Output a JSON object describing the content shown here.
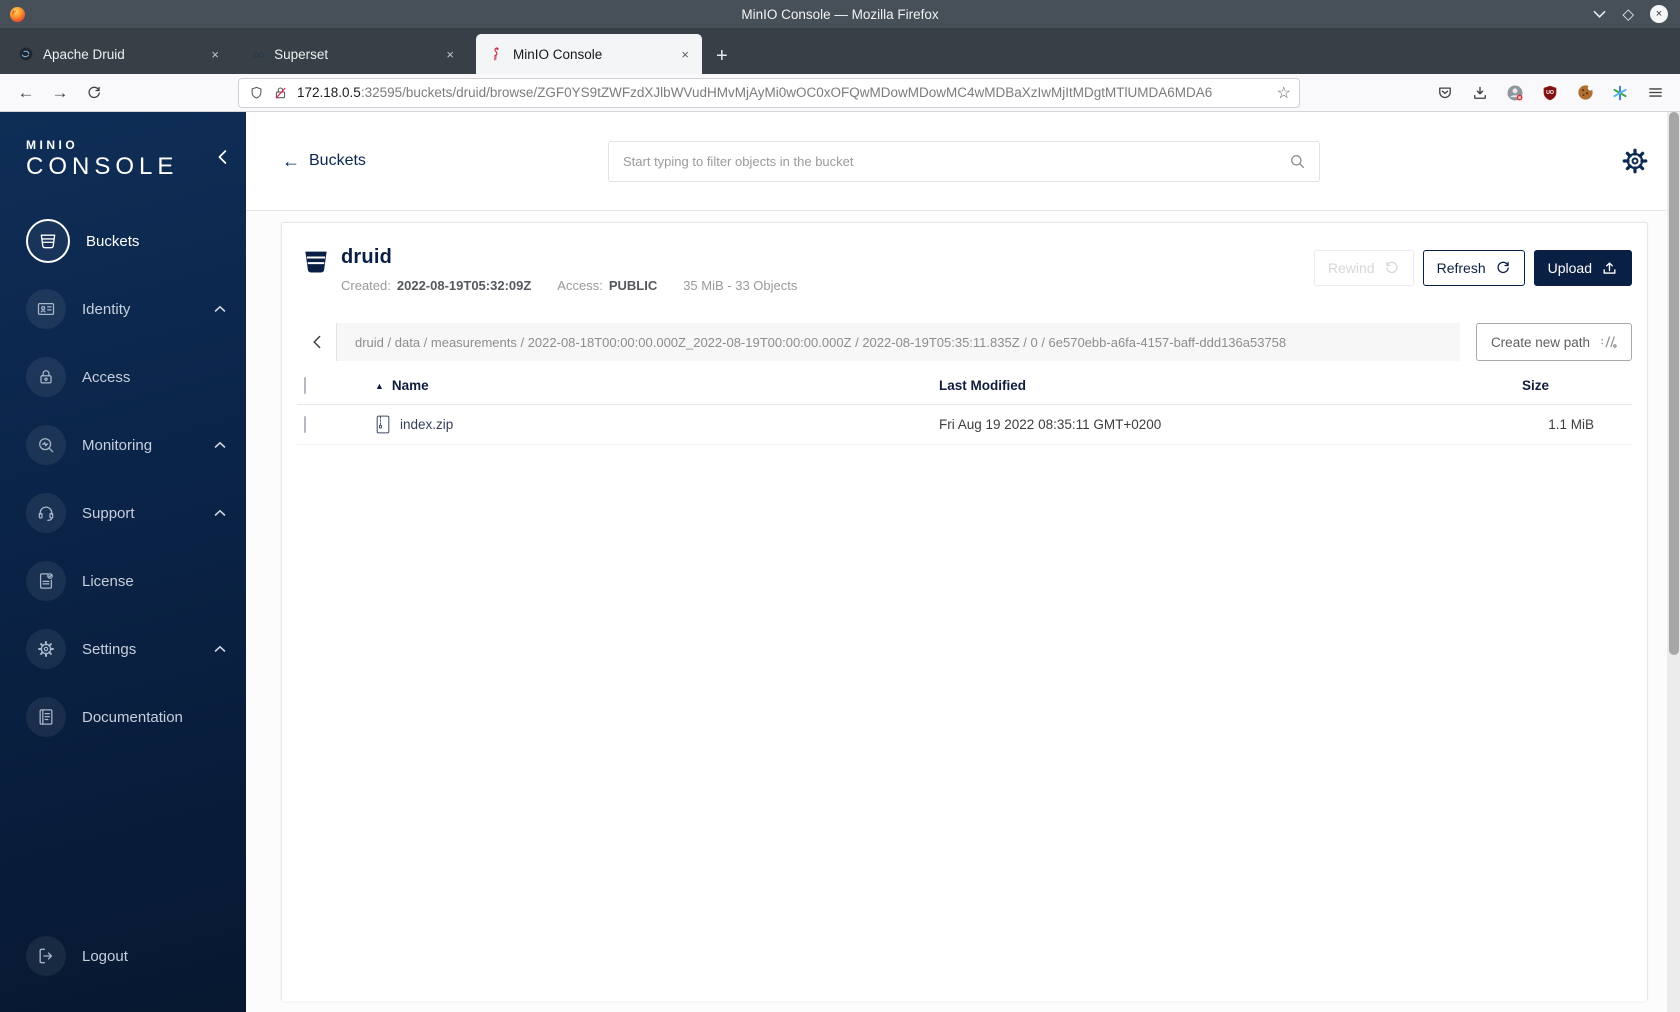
{
  "colors": {
    "accent_navy": "#0a1f44",
    "sidebar_top": "#0f2e57",
    "sidebar_bottom": "#071830",
    "brand_red": "#c72c48",
    "titlebar": "#474f58",
    "tabbar": "#383f46",
    "toolbar_bg": "#f9f9fb",
    "disabled_gray": "#d7d7d7",
    "ublock_red": "#7d1111"
  },
  "window": {
    "title": "MinIO Console — Mozilla Firefox"
  },
  "tabs": [
    {
      "label": "Apache Druid"
    },
    {
      "label": "Superset"
    },
    {
      "label": "MinIO Console"
    }
  ],
  "toolbar": {
    "url_host": "172.18.0.5",
    "url_rest": ":32595/buckets/druid/browse/ZGF0YS9tZWFzdXJlbWVudHMvMjAyMi0wOC0xOFQwMDowMDowMC4wMDBaXzIwMjItMDgtMTlUMDA6MDA6",
    "ublock_badge": "UO"
  },
  "icons": {
    "close_glyph": "×",
    "new_tab": "+",
    "back_arrow": "←",
    "forward_arrow": "→",
    "star": "☆",
    "diamond": "◇",
    "infinity": "∞",
    "sort_asc": "▲"
  },
  "sidebar": {
    "logo_line1": "MINIO",
    "logo_line2": "CONSOLE",
    "items": [
      {
        "label": "Buckets"
      },
      {
        "label": "Identity"
      },
      {
        "label": "Access"
      },
      {
        "label": "Monitoring"
      },
      {
        "label": "Support"
      },
      {
        "label": "License"
      },
      {
        "label": "Settings"
      },
      {
        "label": "Documentation"
      }
    ],
    "logout_label": "Logout"
  },
  "header": {
    "back_label": "Buckets",
    "search_placeholder": "Start typing to filter objects in the bucket"
  },
  "bucket": {
    "name": "druid",
    "created_label": "Created:",
    "created_value": "2022-08-19T05:32:09Z",
    "access_label": "Access:",
    "access_value": "PUBLIC",
    "summary": "35 MiB - 33 Objects",
    "rewind_label": "Rewind",
    "refresh_label": "Refresh",
    "upload_label": "Upload"
  },
  "browse": {
    "breadcrumb": "druid / data / measurements / 2022-08-18T00:00:00.000Z_2022-08-19T00:00:00.000Z / 2022-08-19T05:35:11.835Z / 0 / 6e570ebb-a6fa-4157-baff-ddd136a53758",
    "create_path_label": "Create new path",
    "columns": {
      "name": "Name",
      "modified": "Last Modified",
      "size": "Size"
    },
    "rows": [
      {
        "name": "index.zip",
        "modified": "Fri Aug 19 2022 08:35:11 GMT+0200",
        "size": "1.1 MiB"
      }
    ]
  }
}
